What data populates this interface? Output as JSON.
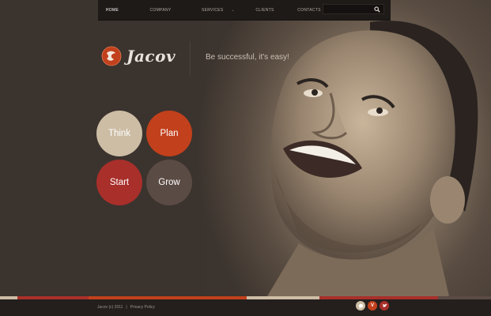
{
  "nav": {
    "items": [
      {
        "label": "HOME",
        "active": true
      },
      {
        "label": "COMPANY",
        "active": false
      },
      {
        "label": "SERVICES",
        "active": false,
        "has_dropdown": true
      },
      {
        "label": "CLIENTS",
        "active": false
      },
      {
        "label": "CONTACTS",
        "active": false
      }
    ],
    "search": {
      "value": "",
      "placeholder": "",
      "icon": "search-icon"
    }
  },
  "brand": {
    "name": "Jacov",
    "logo_icon": "globe-logo-icon",
    "tagline": "Be successful, it's easy!"
  },
  "circles": [
    {
      "label": "Think",
      "color": "#cdbda5"
    },
    {
      "label": "Plan",
      "color": "#c2401c"
    },
    {
      "label": "Start",
      "color": "#a82f2a"
    },
    {
      "label": "Grow",
      "color": "#5b4b45"
    }
  ],
  "hero": {
    "image": "smiling-man-photo"
  },
  "footer": {
    "copyright": "Jacov (c) 2011",
    "separator": "|",
    "privacy_link": "Privacy Policy",
    "social": [
      {
        "icon": "chat-icon",
        "color": "#cdbda5"
      },
      {
        "icon": "vimeo-icon",
        "glyph": "V",
        "color": "#c2401c"
      },
      {
        "icon": "twitter-icon",
        "color": "#a82f2a"
      }
    ]
  },
  "colors": {
    "accent_red": "#c2401c",
    "accent_dark_red": "#a82f2a",
    "beige": "#cdbda5",
    "background": "#2a2523"
  }
}
